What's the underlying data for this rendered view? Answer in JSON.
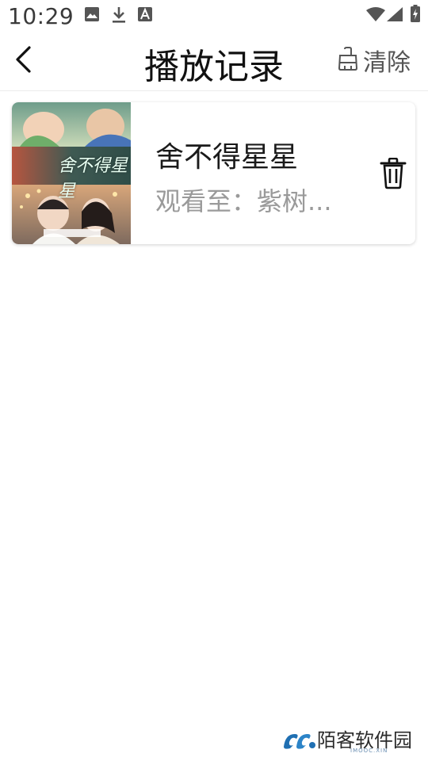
{
  "status_bar": {
    "time": "10:29",
    "left_icons": [
      "image-icon",
      "download-icon",
      "font-icon"
    ],
    "right_icons": [
      "wifi-icon",
      "signal-icon",
      "battery-charging-icon"
    ]
  },
  "header": {
    "back_icon": "chevron-left-icon",
    "title": "播放记录",
    "clear_icon": "broom-icon",
    "clear_label": "清除"
  },
  "records": [
    {
      "poster_text": "舍不得星星",
      "title": "舍不得星星",
      "progress_text": "观看至：紫树...",
      "delete_icon": "trash-icon"
    }
  ],
  "watermark": {
    "logo_icon": "watermark-logo-icon",
    "text": "陌客软件园",
    "subtext": "IMOOC.XIN",
    "color": "#1f6fb2"
  },
  "colors": {
    "background": "#ffffff",
    "title": "#111111",
    "subtitle_gray": "#9a9a9a",
    "divider": "#ececec"
  }
}
